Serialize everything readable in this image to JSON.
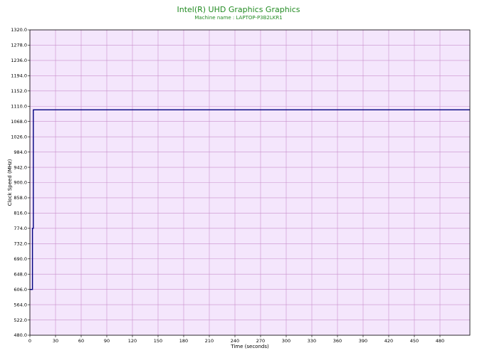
{
  "chart_data": {
    "type": "line",
    "title": "Intel(R) UHD Graphics Graphics",
    "subtitle": "Machine name : LAPTOP-P3B2LKR1",
    "xlabel": "Time (seconds)",
    "ylabel": "Clock Speed (MHz)",
    "xlim": [
      0,
      515
    ],
    "ylim": [
      480.0,
      1320.0
    ],
    "x_ticks": [
      0,
      30,
      60,
      90,
      120,
      150,
      180,
      210,
      240,
      270,
      300,
      330,
      360,
      390,
      420,
      450,
      480
    ],
    "y_ticks": [
      480.0,
      522.0,
      564.0,
      606.0,
      648.0,
      690.0,
      732.0,
      774.0,
      816.0,
      858.0,
      900.0,
      942.0,
      984.0,
      1026.0,
      1068.0,
      1110.0,
      1152.0,
      1194.0,
      1236.0,
      1278.0,
      1320.0
    ],
    "grid": true,
    "series": [
      {
        "x": [
          0,
          3,
          3,
          4,
          4,
          515
        ],
        "y": [
          606.0,
          606.0,
          774.0,
          774.0,
          1100.0,
          1100.0
        ]
      }
    ],
    "colors": {
      "title": "#228b22",
      "plot_background": "#f4e6fc",
      "grid": "#c98fcc",
      "line": "#000080",
      "axis": "#000000"
    }
  }
}
